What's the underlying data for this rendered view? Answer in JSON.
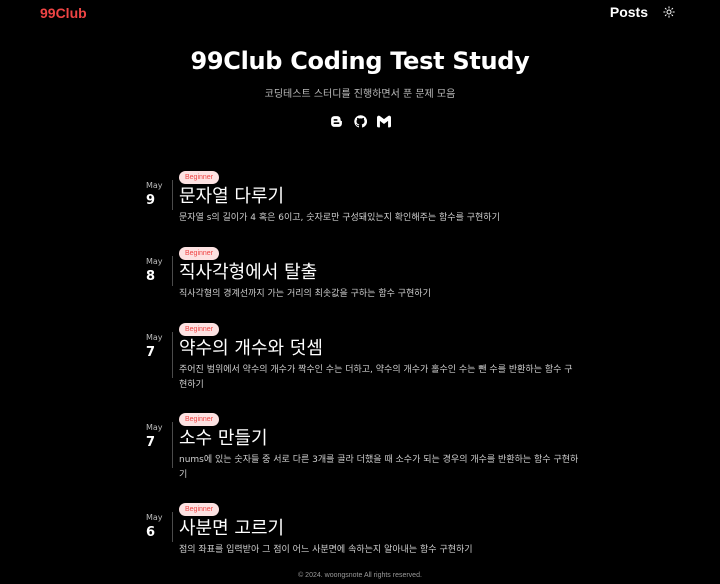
{
  "header": {
    "brand": "99Club",
    "nav_posts": "Posts",
    "theme_icon": "sun-icon"
  },
  "colors": {
    "accent": "#ef4444",
    "background": "#000000",
    "badge_bg": "#fde2e2"
  },
  "hero": {
    "title": "99Club Coding Test Study",
    "subtitle": "코딩테스트 스터디를 진행하면서 푼 문제 모음",
    "icons": [
      "blogger-icon",
      "github-icon",
      "gmail-icon"
    ]
  },
  "posts": [
    {
      "tag": "Beginner",
      "month": "May",
      "day": "9",
      "title": "문자열 다루기",
      "desc": "문자열 s의 길이가 4 혹은 6이고, 숫자로만 구성돼있는지 확인해주는 함수를 구현하기"
    },
    {
      "tag": "Beginner",
      "month": "May",
      "day": "8",
      "title": "직사각형에서 탈출",
      "desc": "직사각형의 경계선까지 가는 거리의 최솟값을 구하는 함수 구현하기"
    },
    {
      "tag": "Beginner",
      "month": "May",
      "day": "7",
      "title": "약수의 개수와 덧셈",
      "desc": "주어진 범위에서 약수의 개수가 짝수인 수는 더하고, 약수의 개수가 홀수인 수는 뺀 수를 반환하는 함수 구현하기"
    },
    {
      "tag": "Beginner",
      "month": "May",
      "day": "7",
      "title": "소수 만들기",
      "desc": "nums에 있는 숫자들 중 서로 다른 3개를 골라 더했을 때 소수가 되는 경우의 개수를 반환하는 함수 구현하기"
    },
    {
      "tag": "Beginner",
      "month": "May",
      "day": "6",
      "title": "사분면 고르기",
      "desc": "점의 좌표를 입력받아 그 점이 어느 사분면에 속하는지 알아내는 함수 구현하기"
    }
  ],
  "footer": {
    "text": "© 2024. woongsnote All rights reserved."
  }
}
